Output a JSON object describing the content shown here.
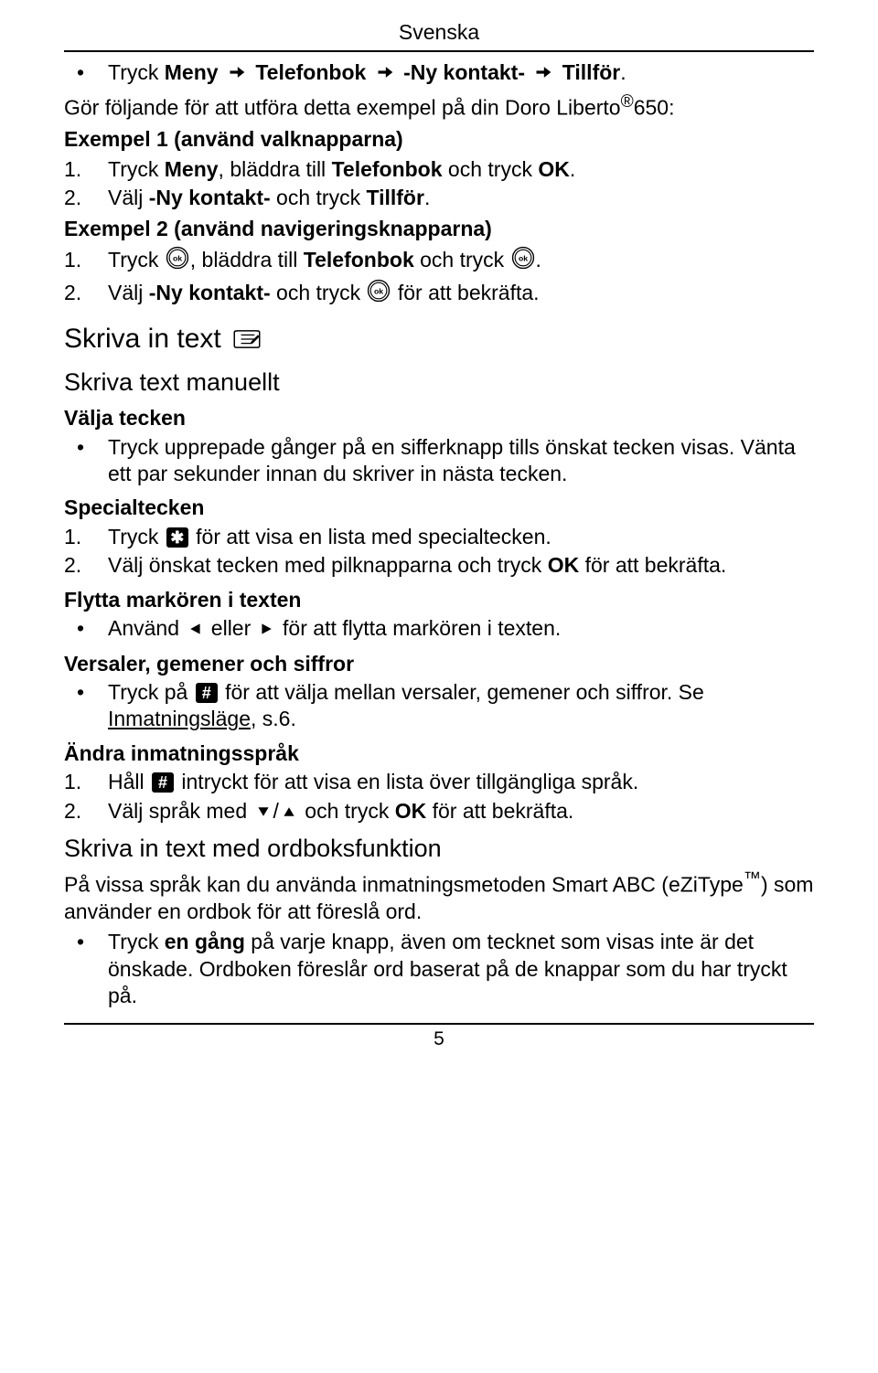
{
  "header": {
    "title": "Svenska"
  },
  "nav": {
    "menu": "Meny",
    "phonebook": "Telefonbok",
    "newcontact": "-Ny kontakt-",
    "add": "Tillför"
  },
  "intro": {
    "prefix": "Tryck ",
    "line1_suffix": ".",
    "line2a": "Gör följande för att utföra detta exempel på din Doro Liberto",
    "sup": "®",
    "line2b": "650:",
    "ex1": "Exempel 1 (använd valknapparna)"
  },
  "ex1_list": {
    "i1a": "Tryck ",
    "i1b": ", bläddra till ",
    "i1c": " och tryck ",
    "i1d": ".",
    "i2a": "Välj ",
    "i2b": " och tryck ",
    "i2c": "."
  },
  "ex2": {
    "title": "Exempel 2 (använd navigeringsknapparna)",
    "i1a": "Tryck ",
    "i1b": ", bläddra till ",
    "i1c": " och tryck ",
    "i1d": ".",
    "i2a": "Välj ",
    "i2b": " och tryck ",
    "i2c": " för att bekräfta."
  },
  "sec1": {
    "title": "Skriva in text"
  },
  "sec2": {
    "title": "Skriva text manuellt"
  },
  "chars": {
    "title": "Välja tecken",
    "b1": "Tryck upprepade gånger på en sifferknapp tills önskat tecken visas. Vänta ett par sekunder innan du skriver in nästa tecken."
  },
  "special": {
    "title": "Specialtecken",
    "i1a": "Tryck ",
    "i1b": " för att visa en lista med specialtecken.",
    "i2a": "Välj önskat tecken med pilknapparna och tryck ",
    "ok": "OK",
    "i2b": " för att bekräfta."
  },
  "cursor": {
    "title": "Flytta markören i texten",
    "b1a": "Använd ",
    "b1b": " eller ",
    "b1c": " för att flytta markören i texten."
  },
  "case": {
    "title": "Versaler, gemener och siffror",
    "b1a": "Tryck på ",
    "b1b": " för att välja mellan versaler, gemener och siffror. Se ",
    "link": "Inmatningsläge",
    "b1c": ", s.6."
  },
  "lang": {
    "title": "Ändra inmatningsspråk",
    "i1a": "Håll ",
    "i1b": " intryckt för att visa en lista över tillgängliga språk.",
    "i2a": "Välj språk med ",
    "i2b": " och tryck ",
    "ok": "OK",
    "i2c": " för att bekräfta."
  },
  "dict": {
    "title": "Skriva in text med ordboksfunktion",
    "p1a": "På vissa språk kan du använda inmatningsmetoden Smart ABC (eZiType",
    "tm": "™",
    "p1b": ") som använder en ordbok för att föreslå ord.",
    "b1a": "Tryck ",
    "b1bold": "en gång",
    "b1b": " på varje knapp, även om tecknet som visas inte är det önskade. Ordboken föreslår ord baserat på de knappar som du har tryckt på."
  },
  "keys": {
    "star": "✱",
    "hash": "#",
    "ok_label": "OK",
    "menu": "Meny",
    "phonebook": "Telefonbok",
    "newcontact": "-Ny kontakt-",
    "add": "Tillför"
  },
  "page": {
    "num": "5"
  }
}
